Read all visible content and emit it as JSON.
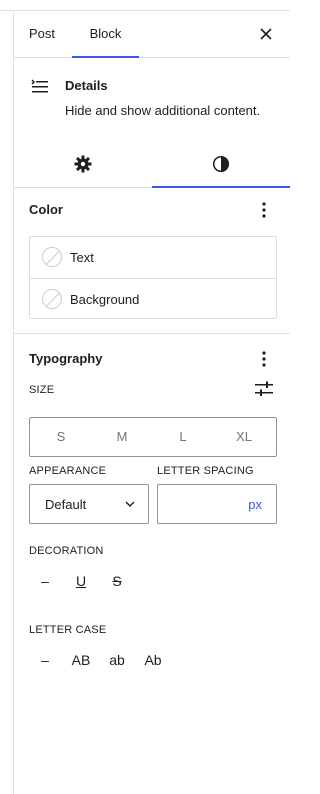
{
  "sidebar": {
    "tabs": [
      {
        "label": "Post"
      },
      {
        "label": "Block"
      }
    ]
  },
  "block": {
    "title": "Details",
    "description": "Hide and show additional content."
  },
  "color": {
    "title": "Color",
    "items": [
      {
        "label": "Text"
      },
      {
        "label": "Background"
      }
    ]
  },
  "typography": {
    "title": "Typography",
    "size_label": "SIZE",
    "sizes": [
      "S",
      "M",
      "L",
      "XL"
    ],
    "appearance_label": "APPEARANCE",
    "appearance_value": "Default",
    "letter_spacing_label": "LETTER SPACING",
    "letter_spacing_unit": "px",
    "decoration_label": "DECORATION",
    "decoration_options": [
      "–",
      "U",
      "S"
    ],
    "letter_case_label": "LETTER CASE",
    "letter_case_options": [
      "–",
      "AB",
      "ab",
      "Ab"
    ]
  },
  "colors": {
    "accent": "#3858e9",
    "text": "#1e1e1e",
    "muted": "#757575",
    "border": "#e0e0e0"
  }
}
